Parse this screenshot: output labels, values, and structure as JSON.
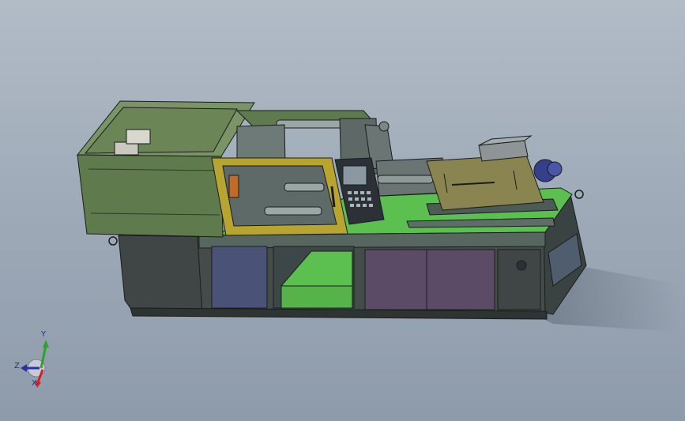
{
  "triad": {
    "y_label": "Y",
    "z_label": "Z",
    "x_label": "X",
    "colors": {
      "x": "#d0202a",
      "y": "#2fa12f",
      "z": "#2233aa"
    }
  },
  "model": {
    "colors": {
      "body_green": "#5f7a4c",
      "body_green_light": "#7b9466",
      "bright_green": "#5cc050",
      "base_dark": "#3f4645",
      "panel_blue": "#4a5278",
      "panel_purple": "#5c4b66",
      "door_yellow": "#b8a531",
      "controller_dark": "#2c3138",
      "hopper_tan": "#8a8550",
      "motor_blue": "#36408a",
      "outline": "#1a1c1e"
    }
  }
}
